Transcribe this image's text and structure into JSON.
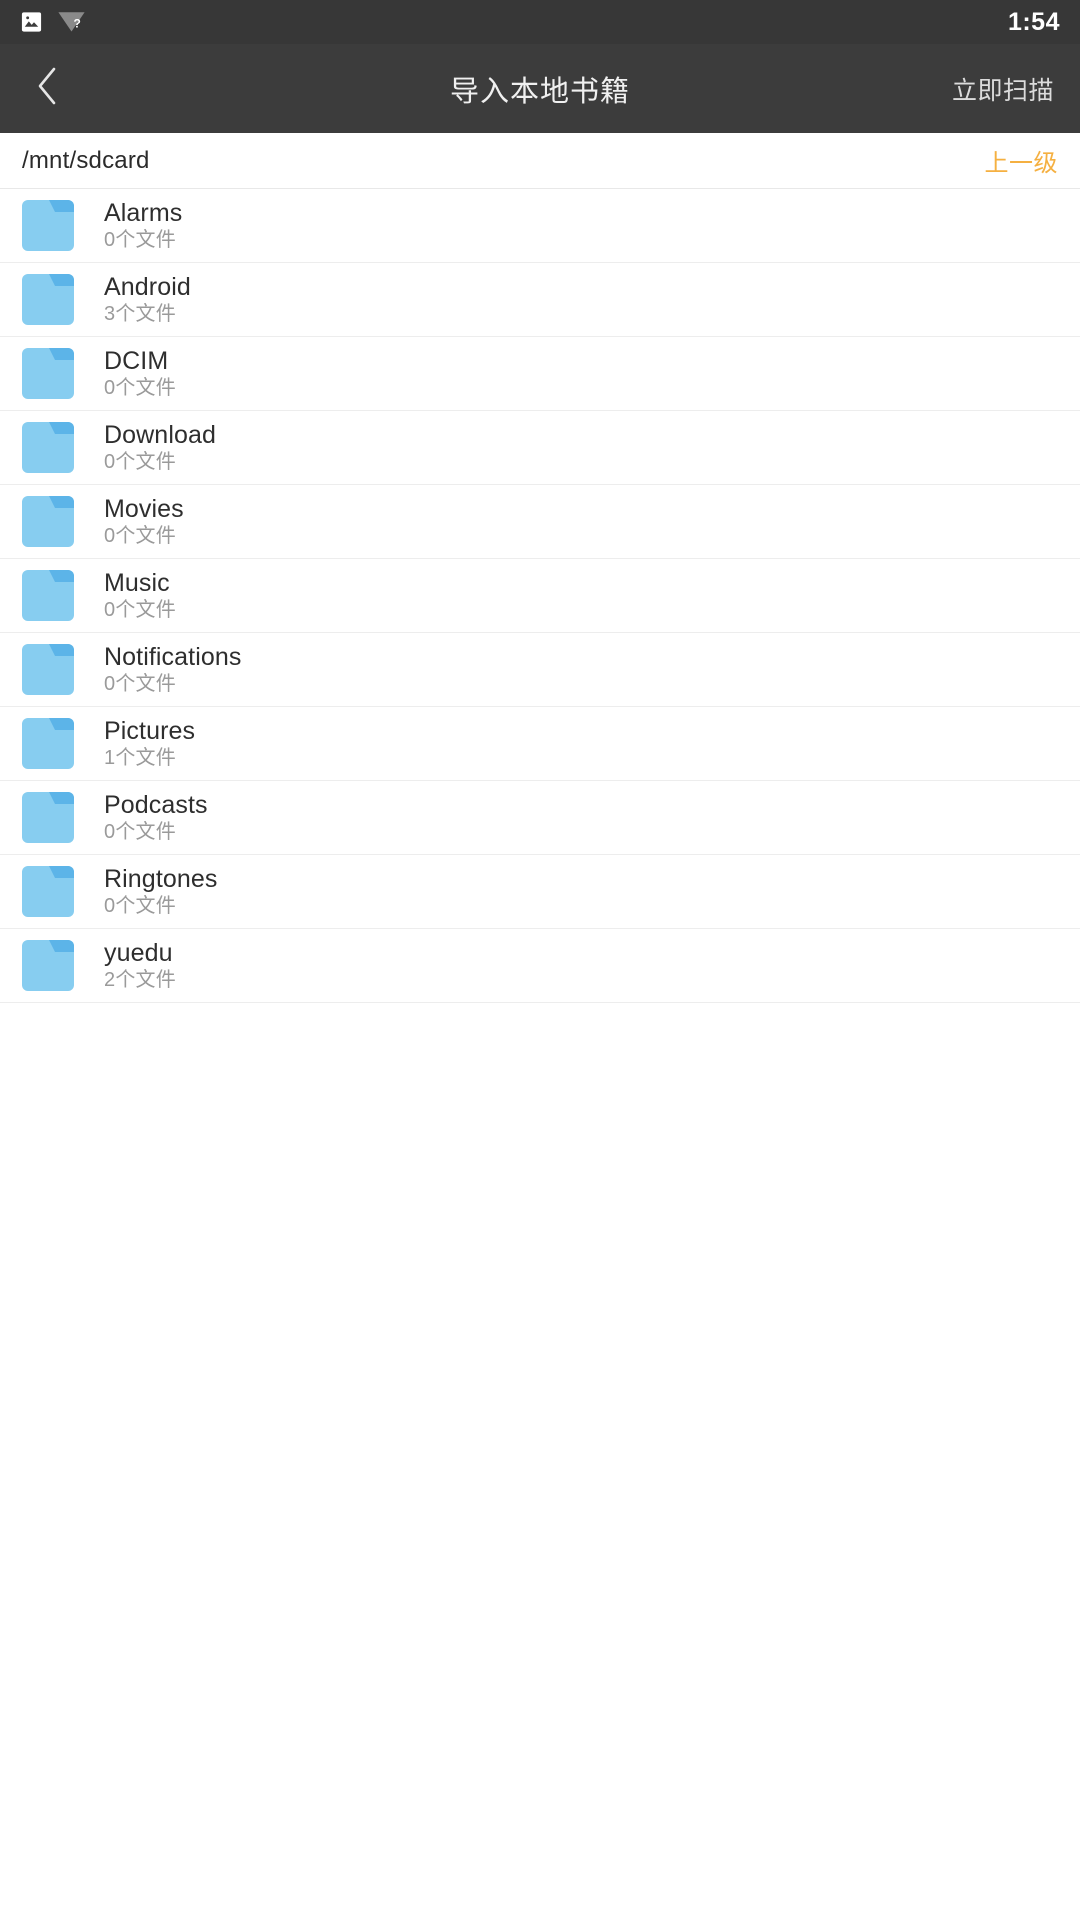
{
  "statusbar": {
    "icons": [
      {
        "name": "photo-icon",
        "glyph": "photo"
      },
      {
        "name": "wifi-question-icon",
        "glyph": "wifi-question"
      }
    ],
    "time": "1:54"
  },
  "appbar": {
    "back_icon": "chevron-left-icon",
    "title": "导入本地书籍",
    "action_label": "立即扫描"
  },
  "pathbar": {
    "path": "/mnt/sdcard",
    "up_label": "上一级",
    "up_color": "#f5b041"
  },
  "colors": {
    "statusbar_bg": "#373737",
    "appbar_bg": "#3c3c3c",
    "page_bg": "#ffffff",
    "folder_fill": "#87cdf0",
    "folder_tab": "#5cb4e8",
    "divider": "#ededed",
    "title_text": "#2e2e2e",
    "sub_text": "#9a9a9a",
    "accent": "#f5b041"
  },
  "list": {
    "icon_name": "folder-icon",
    "items": [
      {
        "name": "Alarms",
        "count": "0个文件"
      },
      {
        "name": "Android",
        "count": "3个文件"
      },
      {
        "name": "DCIM",
        "count": "0个文件"
      },
      {
        "name": "Download",
        "count": "0个文件"
      },
      {
        "name": "Movies",
        "count": "0个文件"
      },
      {
        "name": "Music",
        "count": "0个文件"
      },
      {
        "name": "Notifications",
        "count": "0个文件"
      },
      {
        "name": "Pictures",
        "count": "1个文件"
      },
      {
        "name": "Podcasts",
        "count": "0个文件"
      },
      {
        "name": "Ringtones",
        "count": "0个文件"
      },
      {
        "name": "yuedu",
        "count": "2个文件"
      }
    ]
  }
}
